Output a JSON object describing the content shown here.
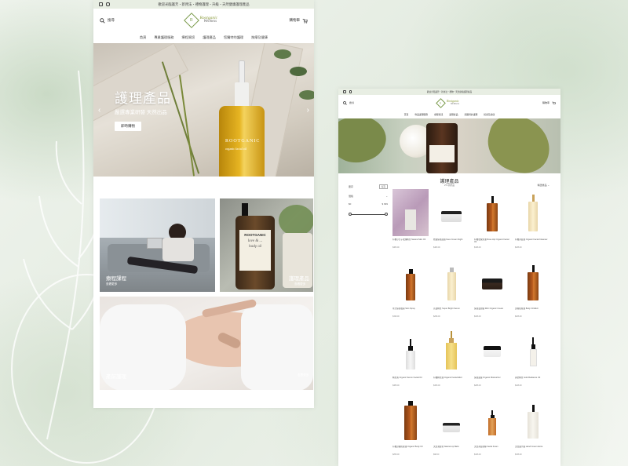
{
  "desktop": {
    "announcement": "歡迎光臨護芳・新用法・禮物護理・升級・天然健康護理產品",
    "search_label": "搜尋",
    "cart_label": "購物車",
    "logo": {
      "line1": "Rootganic",
      "line2": "Wellness",
      "mark": "R"
    },
    "nav": [
      "首頁",
      "專業護理服務",
      "療程資訊",
      "護理產品",
      "您獨特的護理",
      "按摩及健康"
    ],
    "hero": {
      "title": "護理產品",
      "subtitle": "嚴選專業研發 天然出品",
      "button": "即時購物",
      "bottle_label": "ROOTGANIC",
      "bottle_sub": "organic facial oil"
    },
    "tiles": [
      {
        "title": "療程課程",
        "sub": "查看更多"
      },
      {
        "title": "護理產品",
        "sub": "查看更多",
        "bottle_brand": "ROOTGANIC",
        "bottle_line": "love & ...",
        "bottle_type": "body oil"
      },
      {
        "title": "產前護理",
        "sub": "查看更多"
      }
    ]
  },
  "mobile": {
    "announcement": "歡迎光臨護芳・新用法・禮物・天然健康護理產品",
    "search_label": "搜尋",
    "cart_label": "購物車",
    "nav": [
      "首頁",
      "專業護理服務",
      "療程資訊",
      "護理產品",
      "您獨特的護理",
      "按摩及健康"
    ],
    "page_title": "護理產品",
    "count": "25 項產品",
    "filters": {
      "stock_label": "庫存",
      "stock_chip": "有貨",
      "price_label": "價格",
      "min": "$0",
      "max": "$ 999",
      "sort": "精選產品"
    },
    "products": [
      {
        "name": "有機小分子玫瑰精華 Natural Skin Oil",
        "price": "$380.00",
        "kind": "photo"
      },
      {
        "name": "修護保濕面霜 Face Cream Night",
        "price": "$480.00",
        "kind": "jar"
      },
      {
        "name": "有機玫瑰果油 Rose Hip Organic Facial Oil",
        "price": "$198.00",
        "kind": "amber-pump"
      },
      {
        "name": "有機潔面油 Organic Facial Cleanser",
        "price": "$238.00",
        "kind": "clear-pump"
      },
      {
        "name": "水分保濕噴霧 Skin Spray",
        "price": "$198.00",
        "kind": "amber-spray"
      },
      {
        "name": "亮白精華 Super Bright Serum",
        "price": "$298.00",
        "kind": "clear-spray"
      },
      {
        "name": "保濕滋潤霜 Rich Organic Cream",
        "price": "$328.00",
        "kind": "jar-dark"
      },
      {
        "name": "身體按摩油 Body Oil Elixir",
        "price": "$268.00",
        "kind": "amber-pump"
      },
      {
        "name": "精華素 Organic Serum Facial Oil",
        "price": "$388.00",
        "kind": "amber-dropper"
      },
      {
        "name": "有機精華油 Organic Facial Elixir",
        "price": "$308.00",
        "kind": "clear-dropper"
      },
      {
        "name": "保濕面霜 Organic Moisturizer",
        "price": "$288.00",
        "kind": "jar"
      },
      {
        "name": "黃金精華 Gold Radiance Oil",
        "price": "$428.00",
        "kind": "amber-small"
      },
      {
        "name": "有機身體按摩油 Organic Body Oil",
        "price": "$258.00",
        "kind": "amber-big"
      },
      {
        "name": "天然潤唇膏 Natural Lip Balm",
        "price": "$98.00",
        "kind": "jar-small"
      },
      {
        "name": "天然潔面慕絲 Facial Foam",
        "price": "$168.00",
        "kind": "amber-tiny"
      },
      {
        "name": "天然護手霜 Hand Cream Extra",
        "price": "$158.00",
        "kind": "amber-pump"
      }
    ]
  }
}
